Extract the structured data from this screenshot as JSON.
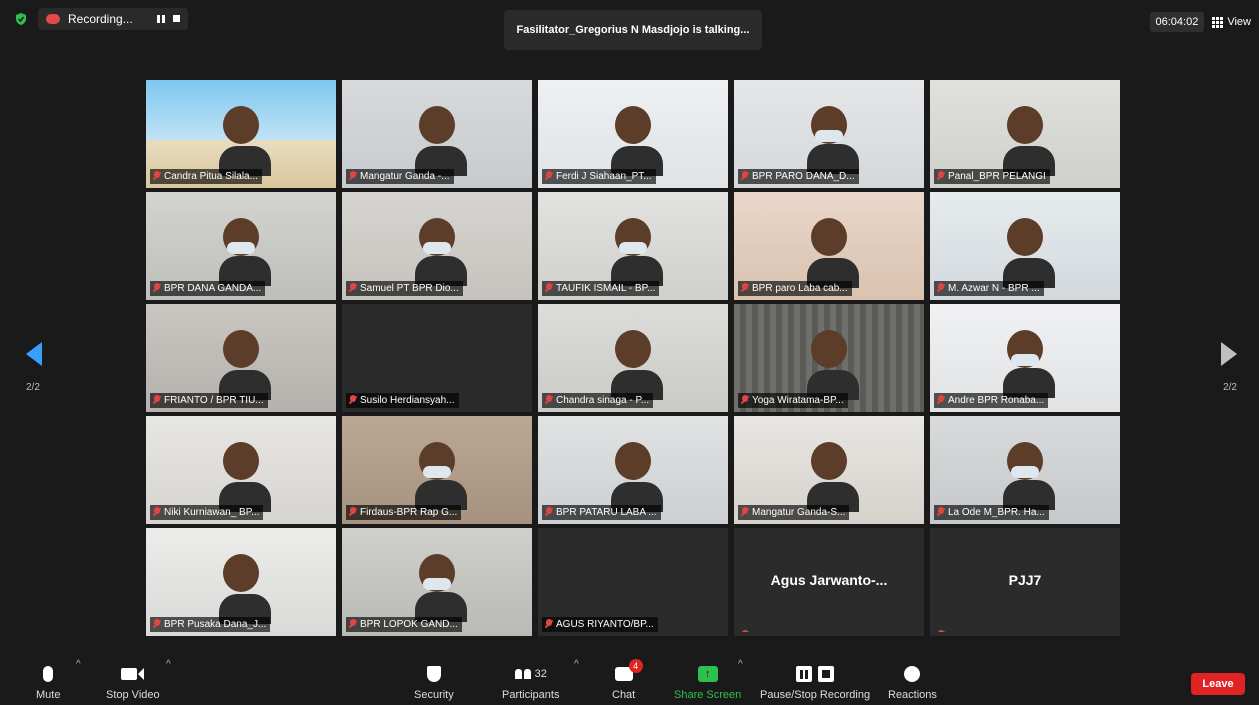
{
  "top_bar": {
    "recording_label": "Recording...",
    "talking_banner": "Fasilitator_Gregorius N Masdjojo is talking...",
    "clock": "06:04:02",
    "view_label": "View"
  },
  "gallery": {
    "page_left_label": "2/2",
    "page_right_label": "2/2",
    "tiles": [
      {
        "name": "Candra Pitua Silala..."
      },
      {
        "name": "Mangatur Ganda -..."
      },
      {
        "name": "Ferdi J Siahaan_PT..."
      },
      {
        "name": "BPR PARO DANA_D..."
      },
      {
        "name": "Panal_BPR PELANGI"
      },
      {
        "name": "BPR DANA GANDA..."
      },
      {
        "name": "Samuel PT BPR Dio..."
      },
      {
        "name": "TAUFIK ISMAIL - BP..."
      },
      {
        "name": "BPR paro Laba cab..."
      },
      {
        "name": "M. Azwar N - BPR ..."
      },
      {
        "name": "FRIANTO / BPR TIU..."
      },
      {
        "name": "Susilo Herdiansyah..."
      },
      {
        "name": "Chandra sinaga - P..."
      },
      {
        "name": "Yoga Wiratama-BP..."
      },
      {
        "name": "Andre BPR Ronaba..."
      },
      {
        "name": "Niki Kurniawan_ BP..."
      },
      {
        "name": "Firdaus-BPR Rap G..."
      },
      {
        "name": "BPR PATARU LABA ..."
      },
      {
        "name": "Mangatur Ganda-S..."
      },
      {
        "name": "La Ode M_BPR. Ha..."
      },
      {
        "name": "BPR Pusaka Dana_J..."
      },
      {
        "name": "BPR LOPOK GAND..."
      },
      {
        "name": "AGUS RIYANTO/BP..."
      },
      {
        "name": "",
        "big_name": "Agus Jarwanto-..."
      },
      {
        "name": "",
        "big_name": "PJJ7"
      }
    ]
  },
  "toolbar": {
    "mute": "Mute",
    "stop_video": "Stop Video",
    "security": "Security",
    "participants": "Participants",
    "participants_count": "32",
    "chat": "Chat",
    "chat_badge": "4",
    "share_screen": "Share Screen",
    "pause_stop_recording": "Pause/Stop Recording",
    "reactions": "Reactions",
    "leave": "Leave"
  },
  "colors": {
    "accent_blue": "#3aa0ff",
    "share_green": "#2fbf4e",
    "leave_red": "#e02424"
  }
}
